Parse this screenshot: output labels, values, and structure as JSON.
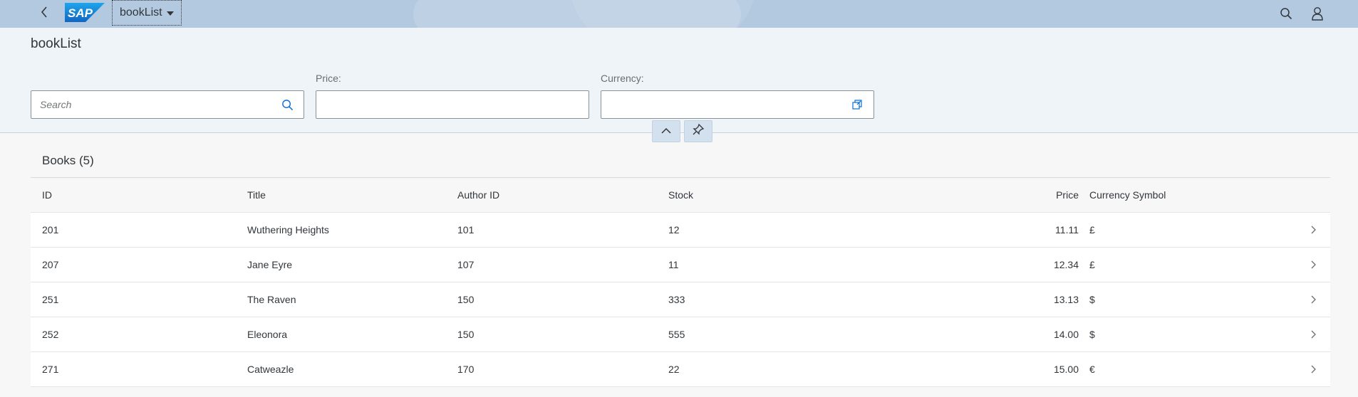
{
  "shell": {
    "app_title": "bookList",
    "logo_text": "SAP"
  },
  "page": {
    "title": "bookList"
  },
  "filters": {
    "search_placeholder": "Search",
    "price_label": "Price:",
    "price_value": "",
    "currency_label": "Currency:",
    "currency_value": ""
  },
  "table": {
    "title": "Books (5)",
    "columns": [
      "ID",
      "Title",
      "Author ID",
      "Stock",
      "Price",
      "Currency Symbol"
    ],
    "rows": [
      {
        "id": "201",
        "title": "Wuthering Heights",
        "author_id": "101",
        "stock": "12",
        "price": "11.11",
        "currency": "£"
      },
      {
        "id": "207",
        "title": "Jane Eyre",
        "author_id": "107",
        "stock": "11",
        "price": "12.34",
        "currency": "£"
      },
      {
        "id": "251",
        "title": "The Raven",
        "author_id": "150",
        "stock": "333",
        "price": "13.13",
        "currency": "$"
      },
      {
        "id": "252",
        "title": "Eleonora",
        "author_id": "150",
        "stock": "555",
        "price": "14.00",
        "currency": "$"
      },
      {
        "id": "271",
        "title": "Catweazle",
        "author_id": "170",
        "stock": "22",
        "price": "15.00",
        "currency": "€"
      }
    ]
  },
  "icons": {
    "back": "chevron-left-icon",
    "search": "search-icon",
    "user": "user-icon",
    "value_help": "value-help-icon",
    "collapse": "chevron-up-icon",
    "pin": "pin-icon",
    "nav": "chevron-right-icon"
  },
  "colors": {
    "shell_bg": "#b3c9e0",
    "header_bg": "#eff4f9",
    "text": "#32363a",
    "logo_blue": "#1a7ad1"
  }
}
